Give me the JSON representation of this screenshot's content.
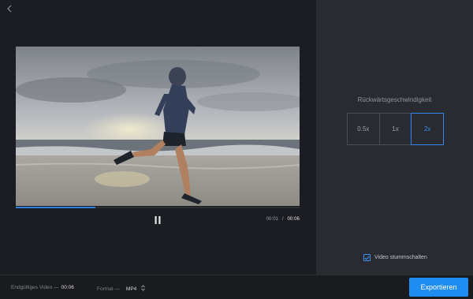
{
  "player": {
    "current_time": "00:01",
    "separator": "/",
    "duration": "00:06",
    "progress": 0.28
  },
  "speed": {
    "label": "Rückwärtsgeschwindigkeit",
    "options": [
      "0.5x",
      "1x",
      "2x"
    ],
    "selected": "2x"
  },
  "mute": {
    "label": "Video stummschalten",
    "checked": true
  },
  "footer": {
    "final_video_label": "Endgültiges Video —",
    "final_video_value": "00:06",
    "format_label": "Format —",
    "format_value": "MP4",
    "export_label": "Exportieren"
  },
  "colors": {
    "accent": "#1f8cf2",
    "panel": "#2a2b30",
    "background": "#1c1d22"
  },
  "icons": {
    "back": "chevron-left-icon",
    "pause": "pause-icon",
    "check": "check-icon",
    "format_arrows": "updown-arrows-icon"
  }
}
